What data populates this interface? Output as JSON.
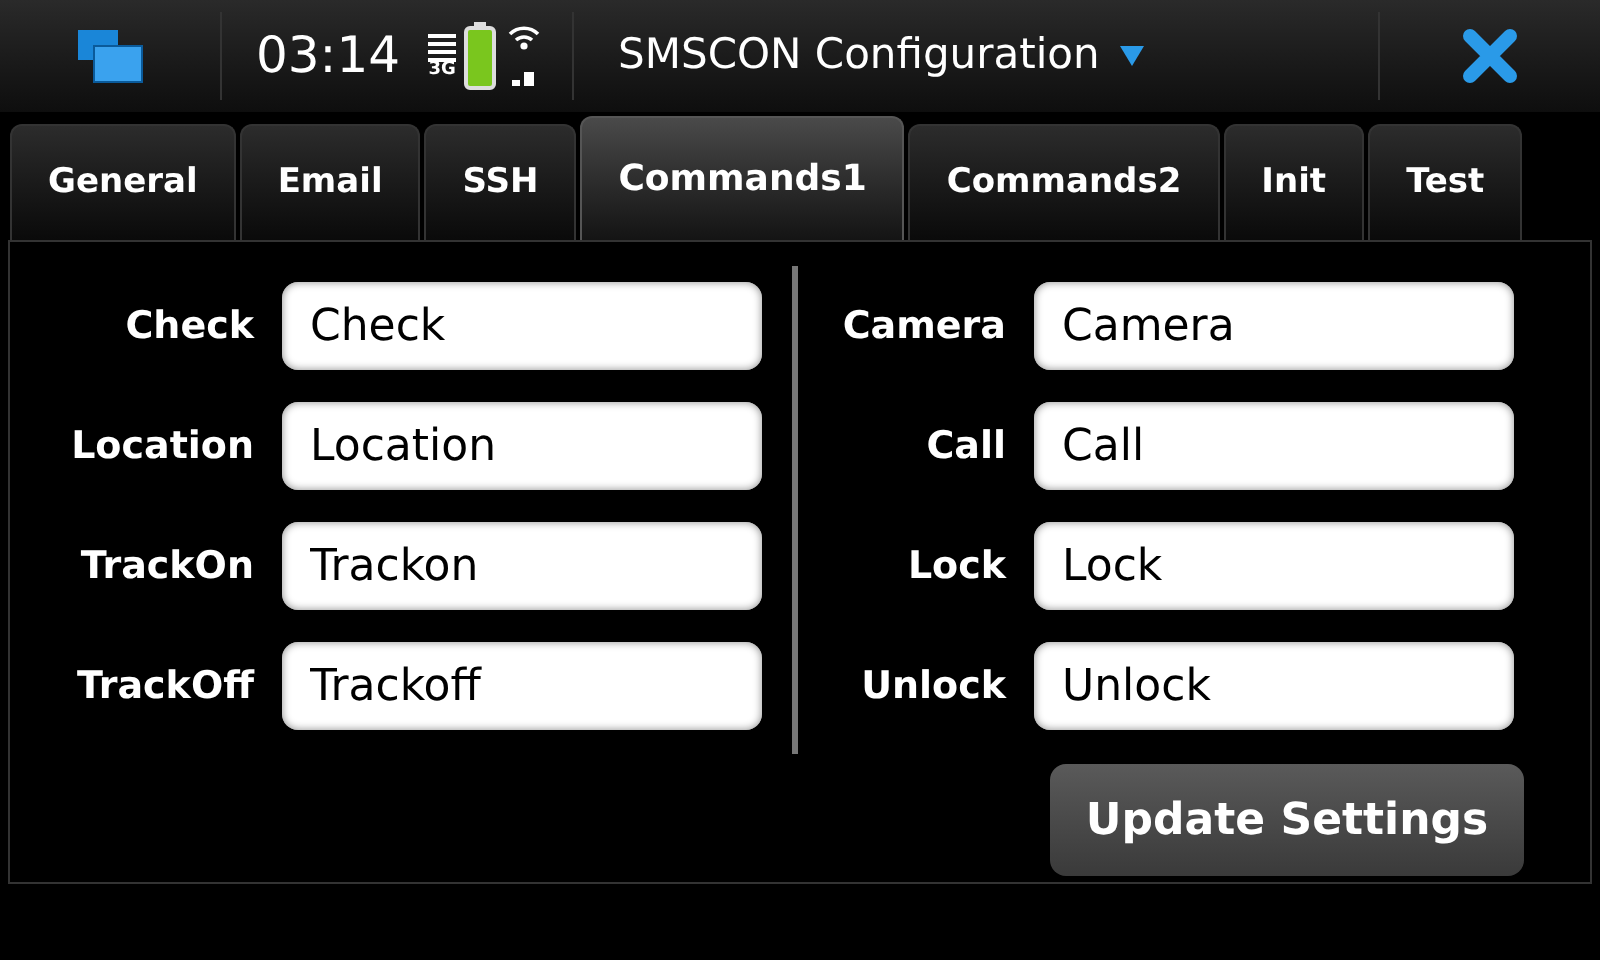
{
  "status_bar": {
    "time": "03:14",
    "network": "3G",
    "title": "SMSCON Configuration"
  },
  "tabs": [
    {
      "label": "General",
      "selected": false
    },
    {
      "label": "Email",
      "selected": false
    },
    {
      "label": "SSH",
      "selected": false
    },
    {
      "label": "Commands1",
      "selected": true
    },
    {
      "label": "Commands2",
      "selected": false
    },
    {
      "label": "Init",
      "selected": false
    },
    {
      "label": "Test",
      "selected": false
    }
  ],
  "columns": [
    [
      {
        "label": "Check",
        "value": "Check"
      },
      {
        "label": "Location",
        "value": "Location"
      },
      {
        "label": "TrackOn",
        "value": "Trackon"
      },
      {
        "label": "TrackOff",
        "value": "Trackoff"
      }
    ],
    [
      {
        "label": "Camera",
        "value": "Camera"
      },
      {
        "label": "Call",
        "value": "Call"
      },
      {
        "label": "Lock",
        "value": "Lock"
      },
      {
        "label": "Unlock",
        "value": "Unlock"
      }
    ]
  ],
  "button": "Update Settings"
}
